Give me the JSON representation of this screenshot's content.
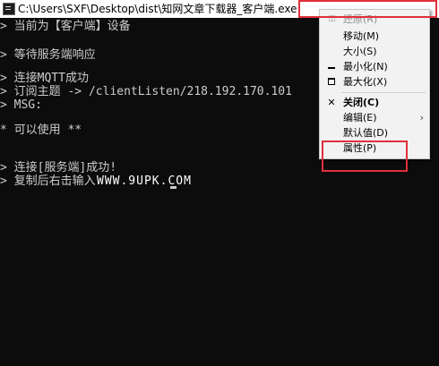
{
  "window": {
    "title": "C:\\Users\\SXF\\Desktop\\dist\\知网文章下载器_客户端.exe",
    "app_icon": "console-app-icon"
  },
  "console": {
    "lines": [
      "> 当前为【客户端】设备",
      "> 等待服务端响应",
      "> 连接MQTT成功",
      "> 订阅主题 -> /clientListen/218.192.170.101",
      "> MSG:",
      "* 可以使用 **",
      "> 连接[服务端]成功!",
      "> 复制后右击输入"
    ],
    "watermark": "WWW.9UPK.COM"
  },
  "system_menu": {
    "items": [
      {
        "label": "还原(R)",
        "icon": "restore-icon",
        "disabled": true
      },
      {
        "label": "移动(M)"
      },
      {
        "label": "大小(S)"
      },
      {
        "label": "最小化(N)",
        "icon": "minimize-icon"
      },
      {
        "label": "最大化(X)",
        "icon": "maximize-icon"
      },
      {
        "label": "关闭(C)",
        "icon": "close-icon",
        "bold": true
      },
      {
        "label": "编辑(E)",
        "submenu": true
      },
      {
        "label": "默认值(D)"
      },
      {
        "label": "属性(P)"
      }
    ]
  },
  "colors": {
    "console_background": "#0c0c0c",
    "console_text": "#cccccc",
    "highlight_box": "#e0303b",
    "menu_background": "#f2f2f2"
  }
}
